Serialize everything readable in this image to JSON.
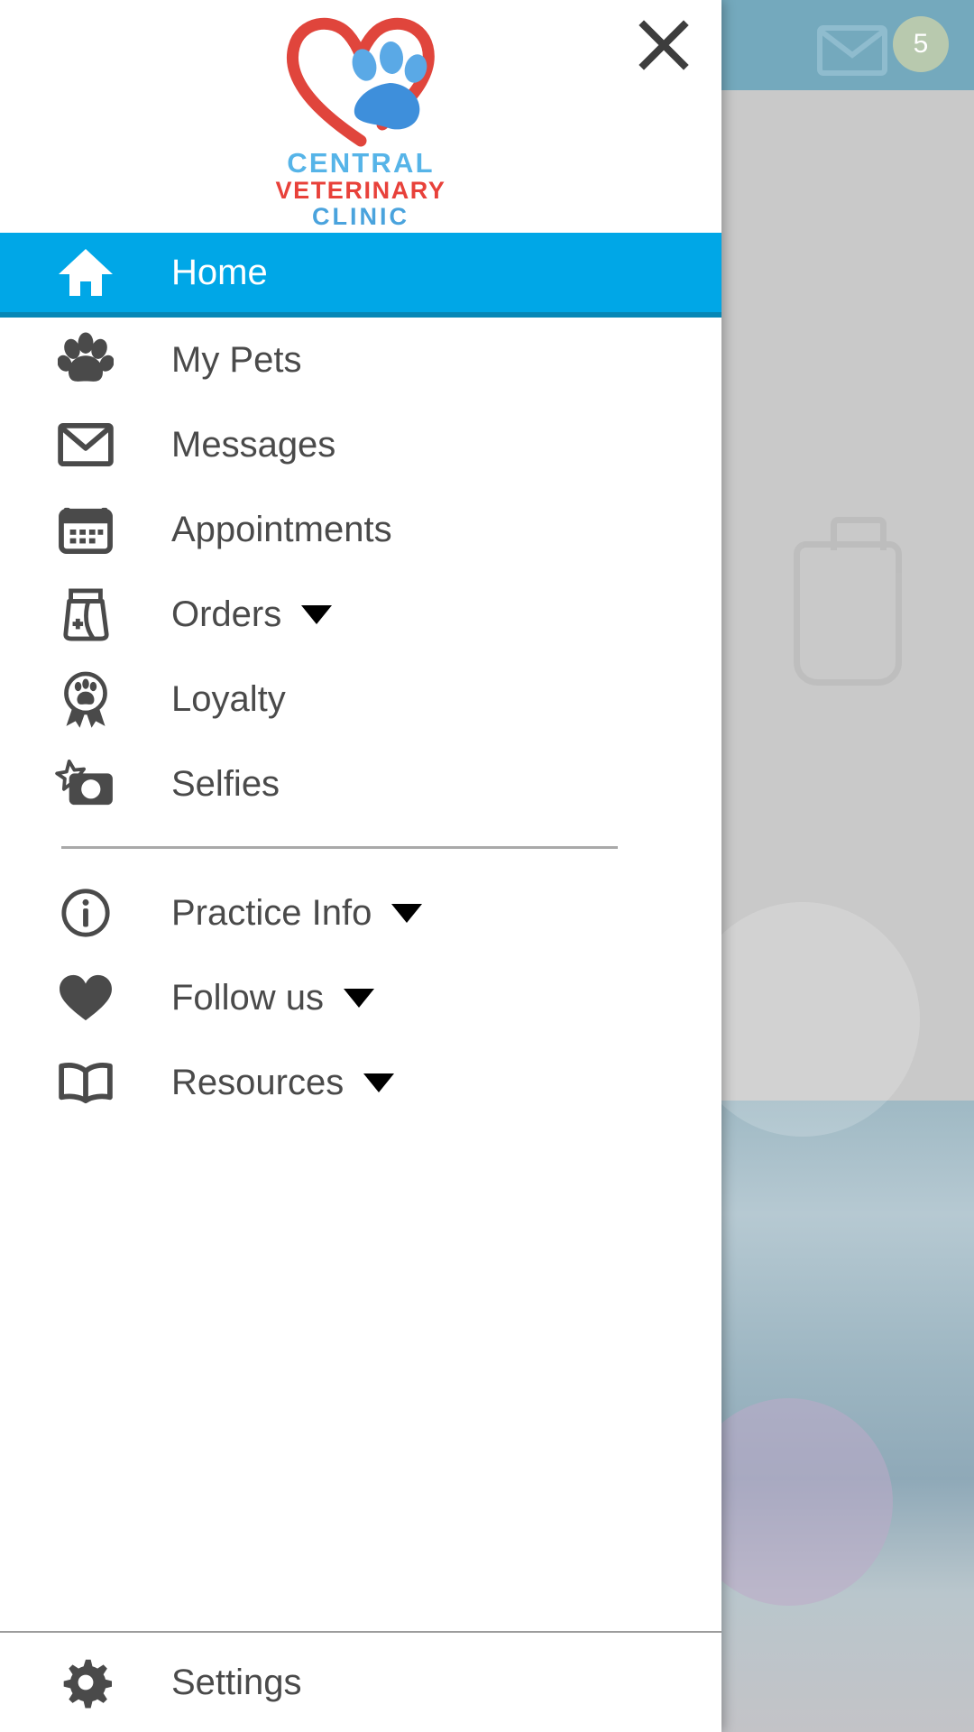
{
  "background": {
    "mail_icon": "mail-icon",
    "badge_count": "5",
    "header_color": "#74a9bd",
    "accent_color": "#00a7e7"
  },
  "drawer": {
    "close_icon": "close-icon",
    "logo": {
      "icon": "heart-paw-logo",
      "line1": "CENTRAL",
      "line2": "VETERINARY",
      "line3": "CLINIC",
      "line1_color": "#56b4e8",
      "line2_color": "#e8413a",
      "line3_color": "#4aa3dd"
    },
    "primary_items": [
      {
        "label": "Home",
        "icon": "home-icon",
        "active": true,
        "has_caret": false
      },
      {
        "label": "My Pets",
        "icon": "paw-icon",
        "active": false,
        "has_caret": false
      },
      {
        "label": "Messages",
        "icon": "envelope-icon",
        "active": false,
        "has_caret": false
      },
      {
        "label": "Appointments",
        "icon": "calendar-icon",
        "active": false,
        "has_caret": false
      },
      {
        "label": "Orders",
        "icon": "food-bag-icon",
        "active": false,
        "has_caret": true
      },
      {
        "label": "Loyalty",
        "icon": "award-paw-icon",
        "active": false,
        "has_caret": false
      },
      {
        "label": "Selfies",
        "icon": "camera-star-icon",
        "active": false,
        "has_caret": false
      }
    ],
    "secondary_items": [
      {
        "label": "Practice Info",
        "icon": "info-circle-icon",
        "has_caret": true
      },
      {
        "label": "Follow us",
        "icon": "heart-icon",
        "has_caret": true
      },
      {
        "label": "Resources",
        "icon": "book-icon",
        "has_caret": true
      }
    ],
    "footer_items": [
      {
        "label": "Settings",
        "icon": "gear-icon",
        "has_caret": false
      }
    ]
  }
}
